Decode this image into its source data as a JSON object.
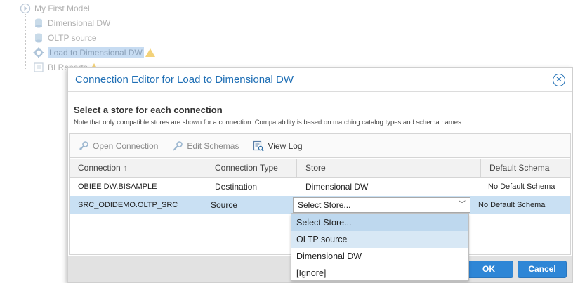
{
  "tree": {
    "root": {
      "label": "My First Model",
      "icon": "model-icon"
    },
    "items": [
      {
        "label": "Dimensional DW",
        "icon": "database-icon"
      },
      {
        "label": "OLTP source",
        "icon": "database-icon"
      },
      {
        "label": "Load to Dimensional DW",
        "icon": "gear-icon",
        "selected": true,
        "warning": true
      },
      {
        "label": "BI Reports",
        "icon": "report-icon",
        "warning": true
      }
    ]
  },
  "dialog": {
    "title": "Connection Editor for Load to Dimensional DW",
    "close_icon": "close-circle-icon",
    "heading": "Select a store for each connection",
    "note": "Note that only compatible stores are shown for a connection. Compatability is based on matching catalog types and schema names.",
    "toolbar": {
      "open_connection": "Open Connection",
      "edit_schemas": "Edit Schemas",
      "view_log": "View Log"
    },
    "columns": {
      "connection": "Connection",
      "connection_type": "Connection Type",
      "store": "Store",
      "default_schema": "Default Schema",
      "sort_icon": "↑"
    },
    "rows": [
      {
        "connection": "OBIEE DW.BISAMPLE",
        "type": "Destination",
        "store": "Dimensional DW",
        "schema": "No Default Schema"
      },
      {
        "connection": "SRC_ODIDEMO.OLTP_SRC",
        "type": "Source",
        "store": "Select Store...",
        "schema": "No Default Schema"
      }
    ],
    "store_options": [
      "Select Store...",
      "OLTP source",
      "Dimensional DW",
      "[Ignore]"
    ],
    "ok": "OK",
    "cancel": "Cancel"
  },
  "colors": {
    "accent": "#1f6fb5",
    "button": "#2e86d6",
    "selected_row": "#c9e0f3"
  }
}
